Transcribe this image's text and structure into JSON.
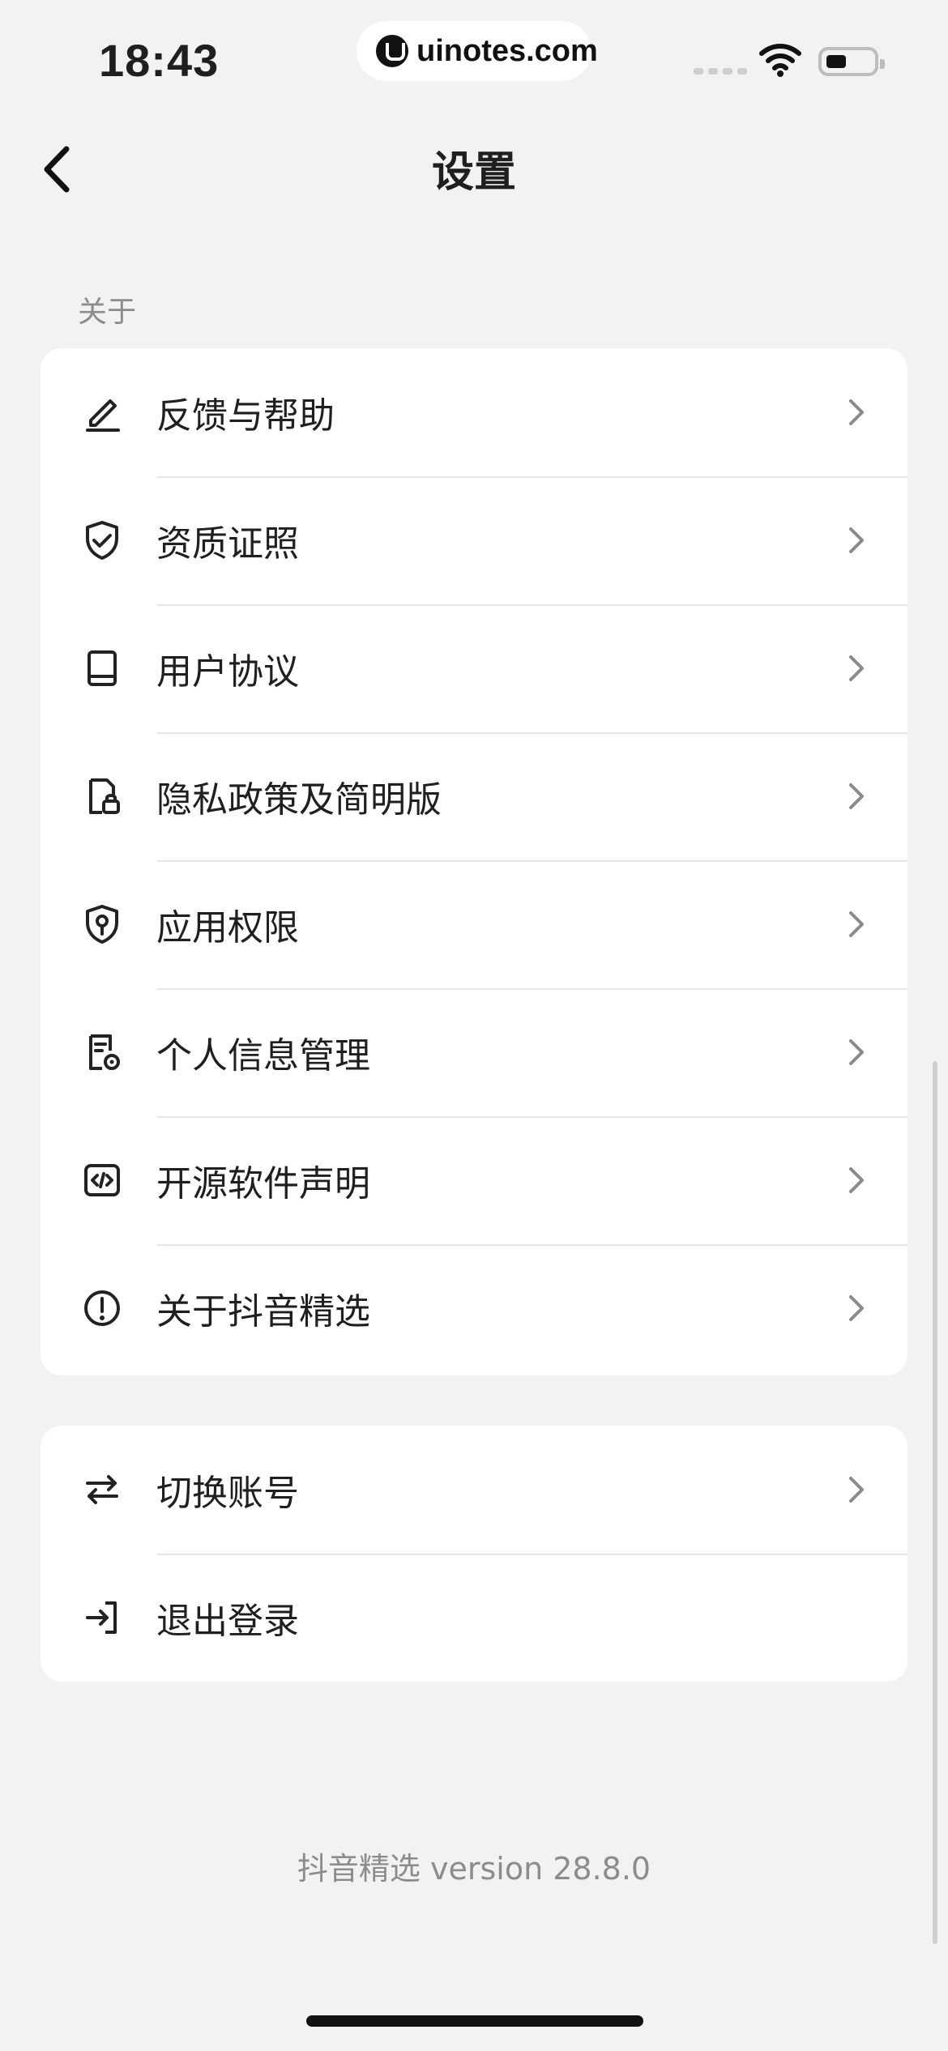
{
  "status_bar": {
    "time": "18:43",
    "watermark_text": "uinotes.com",
    "icons": [
      "signal-icon",
      "wifi-icon",
      "battery-icon"
    ]
  },
  "header": {
    "title": "设置",
    "back_icon": "chevron-left-icon"
  },
  "about_section": {
    "label": "关于",
    "items": [
      {
        "name": "feedback-help",
        "label": "反馈与帮助",
        "icon": "pencil-underline-icon"
      },
      {
        "name": "qualification-license",
        "label": "资质证照",
        "icon": "shield-check-icon"
      },
      {
        "name": "user-agreement",
        "label": "用户协议",
        "icon": "book-icon"
      },
      {
        "name": "privacy-policy",
        "label": "隐私政策及简明版",
        "icon": "doc-lock-icon"
      },
      {
        "name": "app-permissions",
        "label": "应用权限",
        "icon": "shield-key-icon"
      },
      {
        "name": "personal-info-management",
        "label": "个人信息管理",
        "icon": "doc-gear-icon"
      },
      {
        "name": "open-source-notice",
        "label": "开源软件声明",
        "icon": "code-brackets-icon"
      },
      {
        "name": "about-app",
        "label": "关于抖音精选",
        "icon": "info-circle-icon"
      }
    ]
  },
  "account_section": {
    "items": [
      {
        "name": "switch-account",
        "label": "切换账号",
        "icon": "swap-arrows-icon",
        "chevron": true
      },
      {
        "name": "logout",
        "label": "退出登录",
        "icon": "logout-icon",
        "chevron": false
      }
    ]
  },
  "footer": {
    "version_text": "抖音精选 version 28.8.0"
  },
  "colors": {
    "background": "#f2f2f2",
    "card": "#ffffff",
    "text": "#1f1f1f",
    "muted": "#8c8c8c",
    "divider": "#e7e7e7"
  }
}
